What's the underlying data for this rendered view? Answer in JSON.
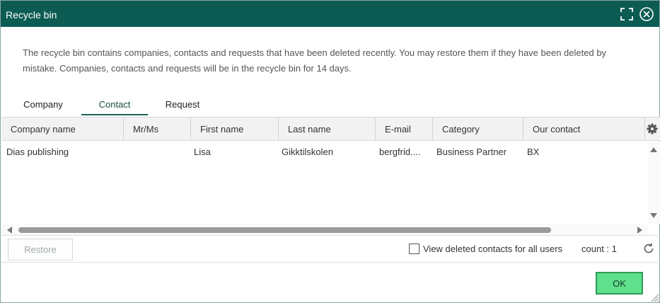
{
  "window": {
    "title": "Recycle bin"
  },
  "intro": "The recycle bin contains companies, contacts and requests that have been deleted recently. You may restore them if they have been deleted by mistake. Companies, contacts and requests will be in the recycle bin for 14 days.",
  "tabs": [
    {
      "label": "Company",
      "active": false
    },
    {
      "label": "Contact",
      "active": true
    },
    {
      "label": "Request",
      "active": false
    }
  ],
  "table": {
    "columns": [
      "Company name",
      "Mr/Ms",
      "First name",
      "Last name",
      "E-mail",
      "Category",
      "Our contact"
    ],
    "rows": [
      [
        "Dias publishing",
        "",
        "Lisa",
        "Gikktilskolen",
        "bergfrid....",
        "Business Partner",
        "BX"
      ]
    ]
  },
  "footer": {
    "restore_label": "Restore",
    "view_all_label": "View deleted contacts for all users",
    "view_all_checked": false,
    "count_text": "count : 1"
  },
  "ok_label": "OK",
  "icons": {
    "maximize": "maximize-icon",
    "close": "close-icon",
    "settings": "gear-icon",
    "refresh": "refresh-icon"
  },
  "colors": {
    "titlebar": "#0d5c53",
    "ok_button": "#5ee08c",
    "active_tab_underline": "#1c6158"
  }
}
